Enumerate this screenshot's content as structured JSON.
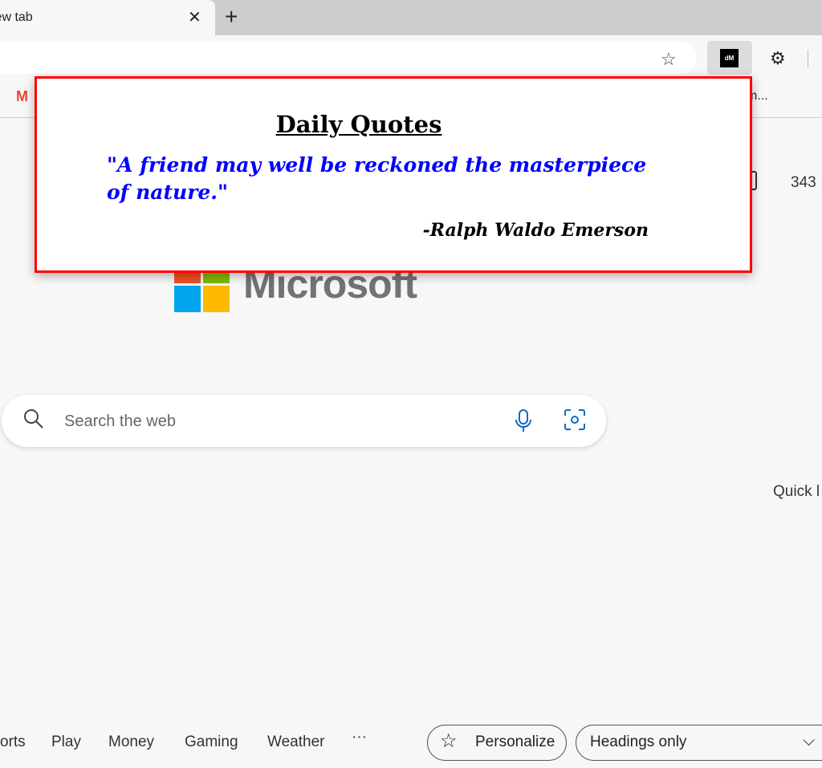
{
  "browser": {
    "tab_title": "New tab",
    "close": "✕",
    "new_tab": "+",
    "bookmarks_more": "m..."
  },
  "extension": {
    "logo_text": "dM"
  },
  "page": {
    "brand": "Microsoft",
    "search_placeholder": "Search the web",
    "count": "343",
    "quick_links": "Quick l",
    "nav": [
      "orts",
      "Play",
      "Money",
      "Gaming",
      "Weather",
      "···"
    ],
    "personalize": "Personalize",
    "feed_select": "Headings only"
  },
  "popup": {
    "title": "Daily Quotes",
    "quote": "\"A friend may well be reckoned the masterpiece of nature.\"",
    "author": "-Ralph Waldo Emerson"
  },
  "colors": {
    "popup_border": "#ff0000",
    "quote": "#0000ff"
  }
}
